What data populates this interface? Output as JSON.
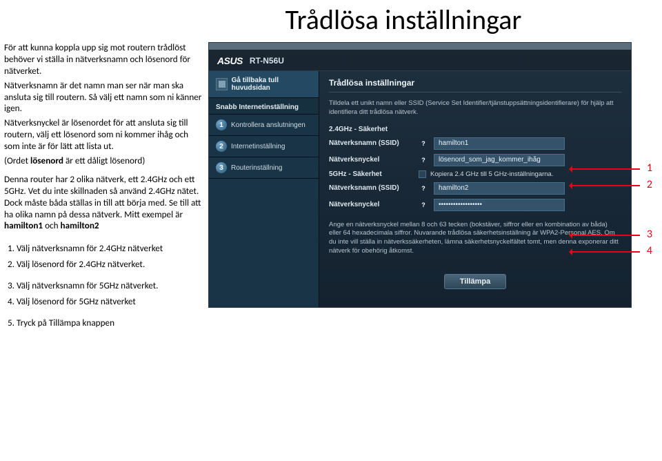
{
  "title": "Trådlösa inställningar",
  "left": {
    "para1a": "För att kunna koppla upp sig mot routern trådlöst behöver vi ställa in nätverksnamn och lösenord för nätverket.",
    "para1b_pre": "Nätverksnamn är det namn man ser när man ska ansluta sig till routern. Så välj ett namn som ni känner igen.",
    "para1c": "Nätverksnyckel är lösenordet för att ansluta sig till routern, välj ett lösenord som ni kommer ihåg och som inte är för lätt att lista ut.",
    "para1d_pre": "(Ordet ",
    "para1d_bold": "lösenord",
    "para1d_post": " är ett dåligt lösenord)",
    "para2_pre": "Denna router har 2 olika nätverk, ett 2.4GHz och ett 5GHz. Vet du inte skillnaden så använd 2.4GHz nätet. Dock måste båda ställas in till att börja med. Se till att ha olika namn på dessa nätverk. Mitt exempel är ",
    "para2_b1": "hamilton1",
    "para2_mid": " och ",
    "para2_b2": "hamilton2",
    "steps": [
      "Välj nätverksnamn för 2.4GHz nätverket",
      "Välj lösenord för 2.4GHz nätverket.",
      "Välj nätverksnamn för 5GHz nätverket.",
      "Välj lösenord för 5GHz nätverket",
      "Tryck på Tillämpa knappen"
    ]
  },
  "router": {
    "logo": "ASUS",
    "model": "RT-N56U",
    "sidebar": {
      "home": "Gå tillbaka tull huvudsidan",
      "section": "Snabb Internetinställning",
      "steps": [
        {
          "n": "1",
          "label": "Kontrollera anslutningen"
        },
        {
          "n": "2",
          "label": "Internetinställning"
        },
        {
          "n": "3",
          "label": "Routerinställning"
        }
      ]
    },
    "panel": {
      "title": "Trådlösa inställningar",
      "desc": "Tilldela ett unikt namn eller SSID (Service Set Identifier/tjänstuppsättningsidentifierare) för hjälp att identifiera ditt trådlösa nätverk.",
      "sub24": "2.4GHz - Säkerhet",
      "ssid_lbl": "Nätverksnamn (SSID)",
      "key_lbl": "Nätverksnyckel",
      "ssid24_val": "hamilton1",
      "key24_val": "lösenord_som_jag_kommer_ihåg",
      "sub5": "5GHz - Säkerhet",
      "copy_lbl": "Kopiera 2.4 GHz till 5 GHz-inställningarna.",
      "ssid5_val": "hamilton2",
      "key5_val": "••••••••••••••••••",
      "note": "Ange en nätverksnyckel mellan 8 och 63 tecken (bokstäver, siffror eller en kombination av båda) eller 64 hexadecimala siffror. Nuvarande trådlösa säkerhetsinställning är WPA2-Personal AES. Om du inte vill ställa in nätverkssäkerheten, lämna säkerhetsnyckelfältet tomt, men denna exponerar ditt nätverk för obehörig åtkomst.",
      "apply": "Tillämpa"
    }
  },
  "arrows": [
    "1",
    "2",
    "3",
    "4"
  ]
}
